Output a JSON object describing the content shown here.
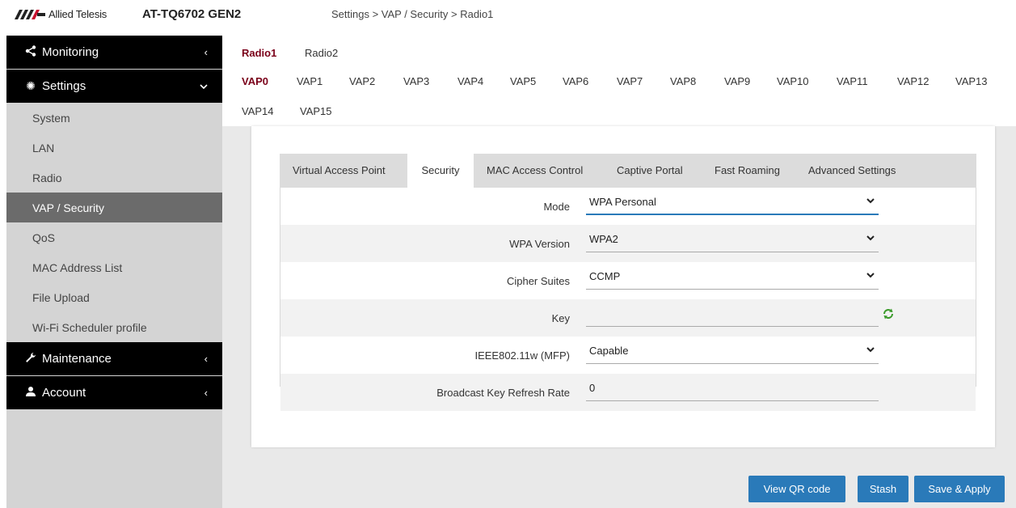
{
  "header": {
    "brand": "Allied Telesis",
    "device_name": "AT-TQ6702 GEN2",
    "breadcrumb": "Settings > VAP / Security > Radio1"
  },
  "sidebar": {
    "monitoring": {
      "label": "Monitoring",
      "icon": "share-icon"
    },
    "settings": {
      "label": "Settings",
      "icon": "gear-icon",
      "items": [
        {
          "label": "System"
        },
        {
          "label": "LAN"
        },
        {
          "label": "Radio"
        },
        {
          "label": "VAP / Security",
          "active": true
        },
        {
          "label": "QoS"
        },
        {
          "label": "MAC Address List"
        },
        {
          "label": "File Upload"
        },
        {
          "label": "Wi-Fi Scheduler profile"
        }
      ]
    },
    "maintenance": {
      "label": "Maintenance",
      "icon": "wrench-icon"
    },
    "account": {
      "label": "Account",
      "icon": "user-icon"
    }
  },
  "radio_tabs": [
    {
      "label": "Radio1",
      "active": true
    },
    {
      "label": "Radio2"
    }
  ],
  "vap_tabs": [
    {
      "label": "VAP0",
      "active": true
    },
    {
      "label": "VAP1"
    },
    {
      "label": "VAP2"
    },
    {
      "label": "VAP3"
    },
    {
      "label": "VAP4"
    },
    {
      "label": "VAP5"
    },
    {
      "label": "VAP6"
    },
    {
      "label": "VAP7"
    },
    {
      "label": "VAP8"
    },
    {
      "label": "VAP9"
    },
    {
      "label": "VAP10"
    },
    {
      "label": "VAP11"
    },
    {
      "label": "VAP12"
    },
    {
      "label": "VAP13"
    },
    {
      "label": "VAP14"
    },
    {
      "label": "VAP15"
    }
  ],
  "inner_tabs": [
    {
      "label": "Virtual Access Point"
    },
    {
      "label": "Security",
      "active": true
    },
    {
      "label": "MAC Access Control"
    },
    {
      "label": "Captive Portal"
    },
    {
      "label": "Fast Roaming"
    },
    {
      "label": "Advanced Settings"
    }
  ],
  "form": {
    "mode": {
      "label": "Mode",
      "value": "WPA Personal"
    },
    "wpa_version": {
      "label": "WPA Version",
      "value": "WPA2"
    },
    "cipher_suites": {
      "label": "Cipher Suites",
      "value": "CCMP"
    },
    "key": {
      "label": "Key",
      "value": ""
    },
    "mfp": {
      "label": "IEEE802.11w (MFP)",
      "value": "Capable"
    },
    "refresh_rate": {
      "label": "Broadcast Key Refresh Rate",
      "value": "0"
    }
  },
  "buttons": {
    "view_qr": "View QR code",
    "stash": "Stash",
    "save_apply": "Save & Apply"
  },
  "colors": {
    "accent_blue": "#2a7ab9",
    "active_tab_red": "#7a0019",
    "sidebar_bg": "#d4d4d4",
    "sidebar_active": "#6b6b6b",
    "section_bg": "#000000"
  }
}
